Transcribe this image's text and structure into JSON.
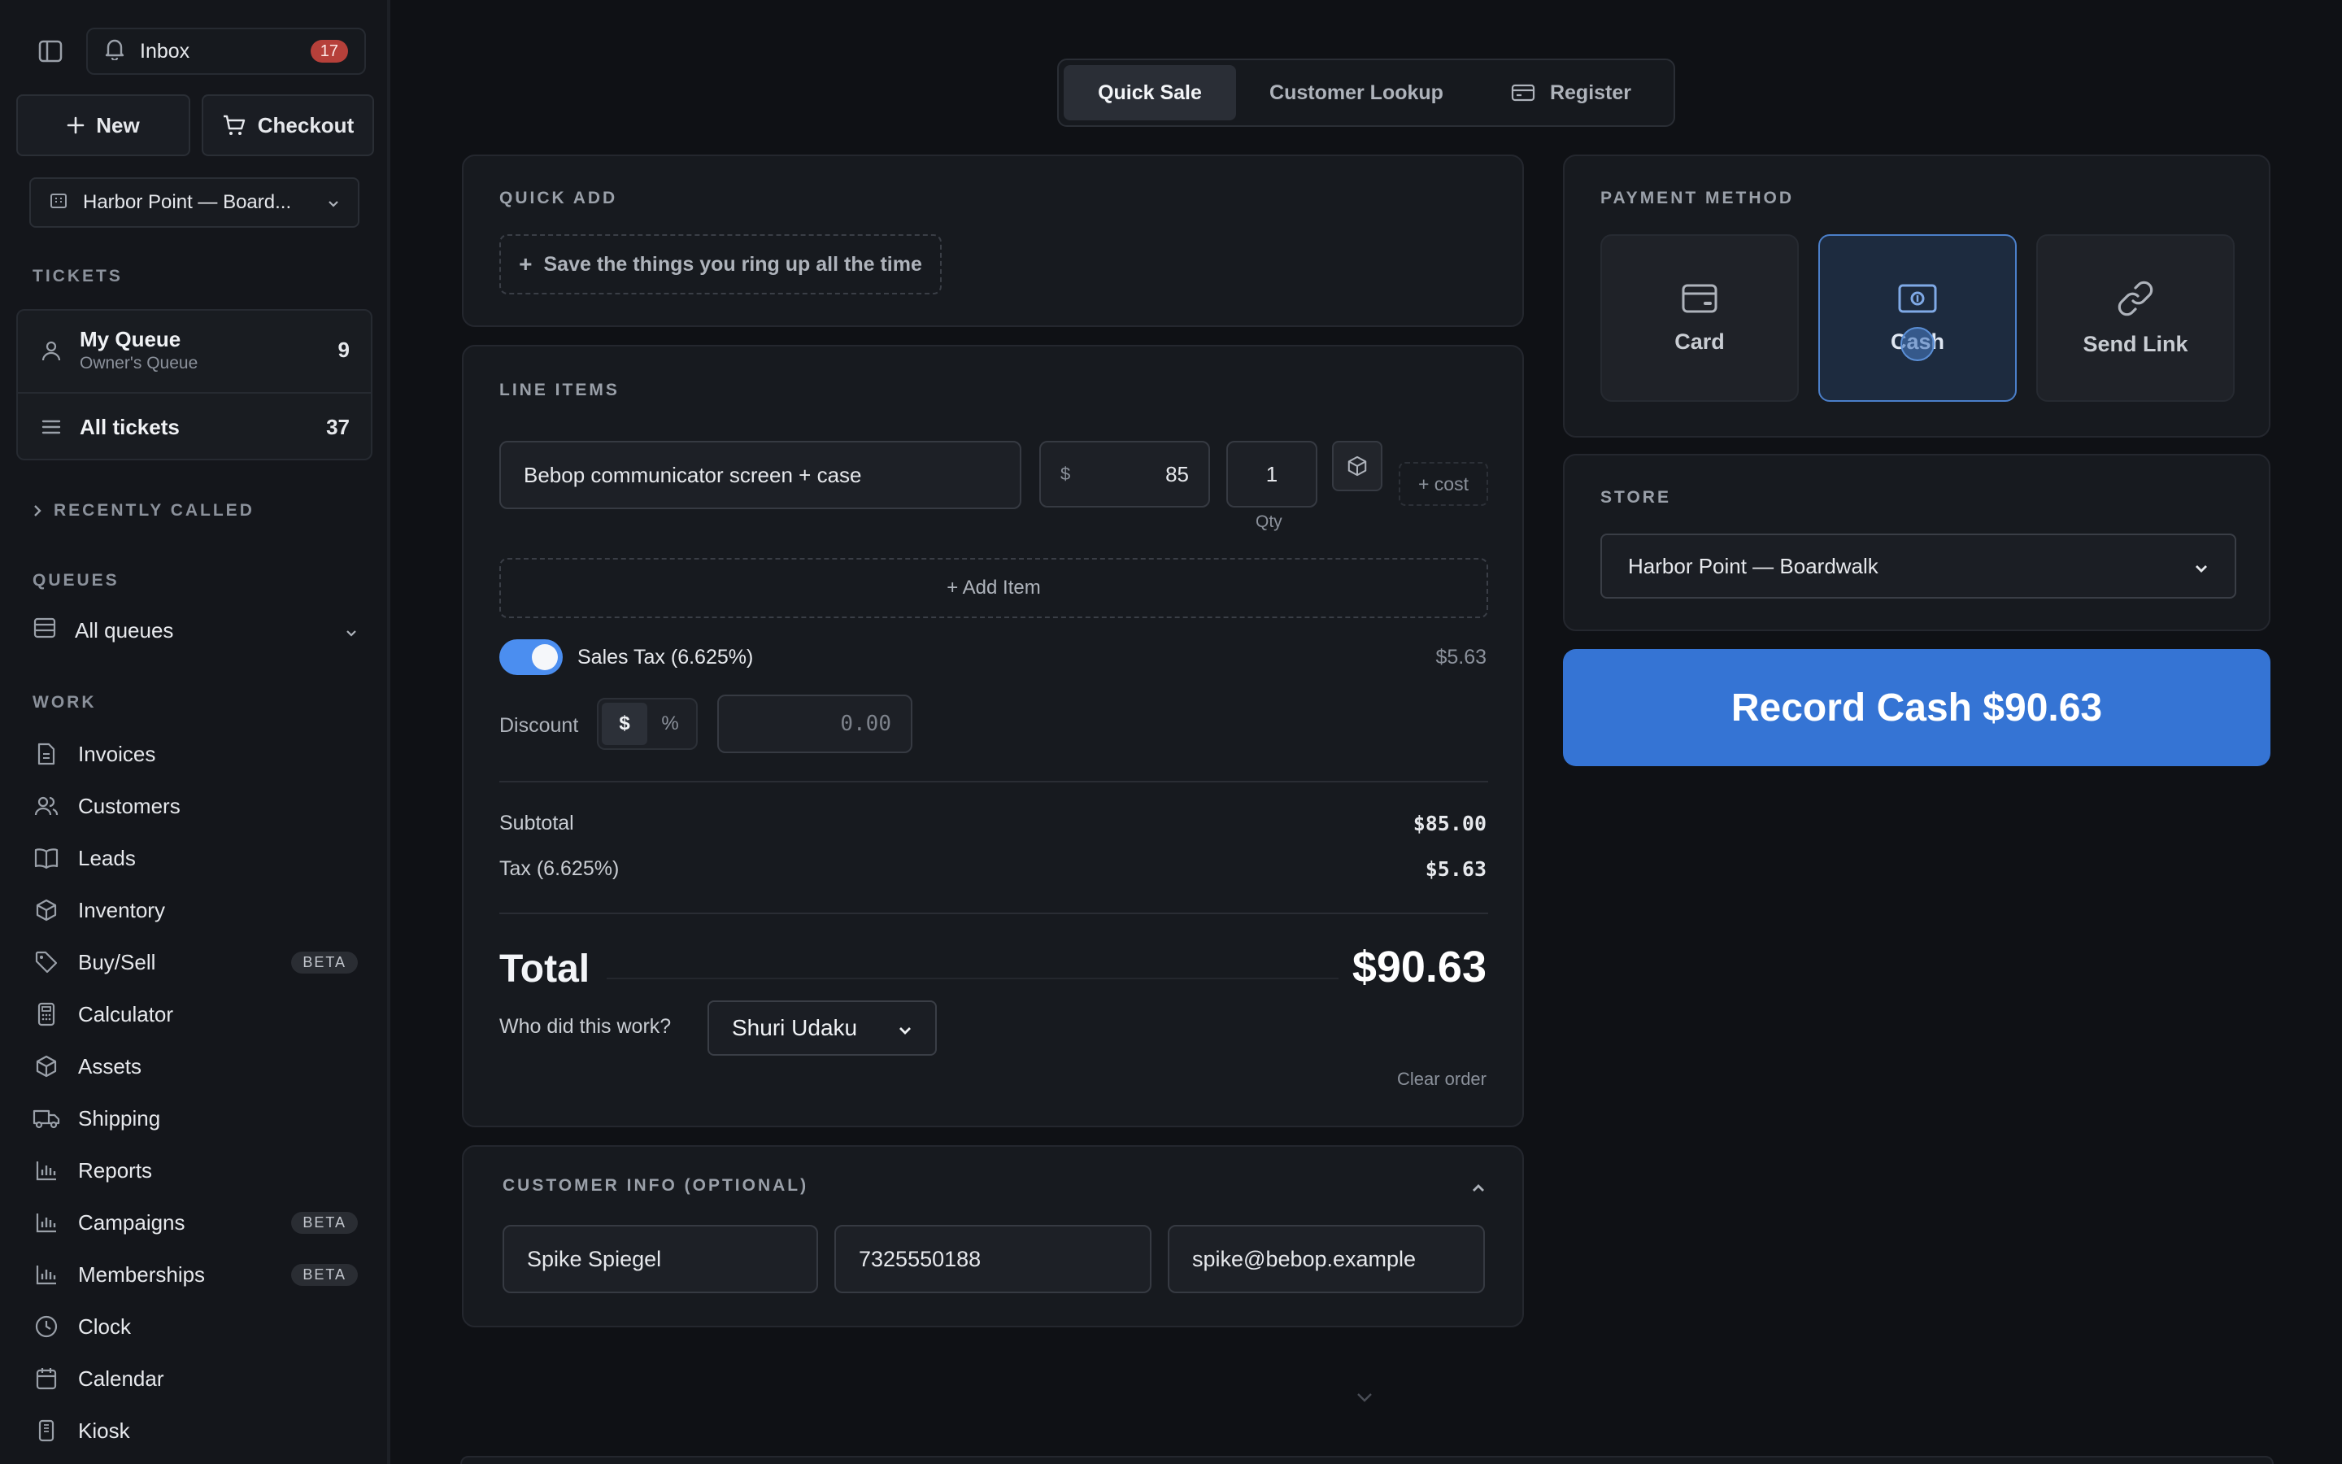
{
  "sidebar": {
    "inbox_label": "Inbox",
    "inbox_count": "17",
    "new_label": "New",
    "checkout_label": "Checkout",
    "store": "Harbor Point — Board...",
    "tickets_heading": "TICKETS",
    "my_queue": {
      "label": "My Queue",
      "sub": "Owner's Queue",
      "count": "9"
    },
    "all_tickets": {
      "label": "All tickets",
      "count": "37"
    },
    "recently_called": "RECENTLY CALLED",
    "queues_heading": "QUEUES",
    "queues_select": "All queues",
    "work_heading": "WORK",
    "nav": [
      {
        "label": "Invoices",
        "icon": "file-icon"
      },
      {
        "label": "Customers",
        "icon": "users-icon"
      },
      {
        "label": "Leads",
        "icon": "book-icon"
      },
      {
        "label": "Inventory",
        "icon": "box-icon"
      },
      {
        "label": "Buy/Sell",
        "icon": "tag-icon",
        "badge": "BETA"
      },
      {
        "label": "Calculator",
        "icon": "calculator-icon"
      },
      {
        "label": "Assets",
        "icon": "cube-icon"
      },
      {
        "label": "Shipping",
        "icon": "truck-icon"
      },
      {
        "label": "Reports",
        "icon": "bar-chart-icon"
      },
      {
        "label": "Campaigns",
        "icon": "bar-chart-icon",
        "badge": "BETA"
      },
      {
        "label": "Memberships",
        "icon": "bar-chart-icon",
        "badge": "BETA"
      },
      {
        "label": "Clock",
        "icon": "clock-icon"
      },
      {
        "label": "Calendar",
        "icon": "calendar-icon"
      },
      {
        "label": "Kiosk",
        "icon": "tablet-icon"
      }
    ]
  },
  "tabs": [
    {
      "label": "Quick Sale",
      "active": true
    },
    {
      "label": "Customer Lookup",
      "active": false
    },
    {
      "label": "Register",
      "active": false,
      "icon": "register-icon"
    }
  ],
  "quick_add": {
    "heading": "QUICK ADD",
    "button": "Save the things you ring up all the time"
  },
  "line_items": {
    "heading": "LINE ITEMS",
    "items": [
      {
        "description": "Bebop communicator screen + case",
        "currency": "$",
        "price": "85",
        "qty": "1"
      }
    ],
    "qty_label": "Qty",
    "cost_button": "+ cost",
    "add_item": "+ Add Item",
    "sales_tax_label": "Sales Tax (6.625%)",
    "sales_tax_amount": "$5.63",
    "sales_tax_enabled": true,
    "discount_label": "Discount",
    "discount_modes": [
      "$",
      "%"
    ],
    "discount_mode_selected": "$",
    "discount_placeholder": "0.00",
    "subtotal_label": "Subtotal",
    "subtotal_value": "$85.00",
    "tax_label": "Tax (6.625%)",
    "tax_value": "$5.63",
    "total_label": "Total",
    "total_value": "$90.63",
    "worker_label": "Who did this work?",
    "worker_value": "Shuri Udaku",
    "clear_order": "Clear order"
  },
  "customer_info": {
    "heading": "CUSTOMER INFO (OPTIONAL)",
    "name": "Spike Spiegel",
    "phone": "7325550188",
    "email": "spike@bebop.example"
  },
  "payment": {
    "heading": "PAYMENT METHOD",
    "options": [
      {
        "label": "Card",
        "icon": "card-icon",
        "selected": false
      },
      {
        "label": "Cash",
        "icon": "cash-icon",
        "selected": true
      },
      {
        "label": "Send Link",
        "icon": "link-icon",
        "selected": false
      }
    ]
  },
  "store": {
    "heading": "STORE",
    "value": "Harbor Point — Boardwalk"
  },
  "record_button": "Record Cash $90.63",
  "colors": {
    "accent": "#3574d4",
    "toggle": "#4b8ef0",
    "badge_red": "#b6403a",
    "background": "#0f1115"
  }
}
